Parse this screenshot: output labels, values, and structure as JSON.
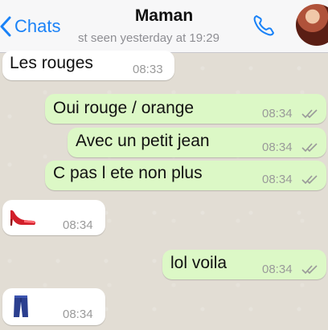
{
  "header": {
    "back_label": "Chats",
    "title": "Maman",
    "subtitle": "st seen yesterday at 19:29",
    "accent": "#1a82f7"
  },
  "messages": [
    {
      "direction": "in",
      "text": "Les rouges",
      "time": "08:33"
    },
    {
      "direction": "out",
      "text": "Oui rouge / orange",
      "time": "08:34",
      "status": "read"
    },
    {
      "direction": "out",
      "text": "Avec un petit jean",
      "time": "08:34",
      "status": "read"
    },
    {
      "direction": "out",
      "text": "C pas l ete non plus",
      "time": "08:34",
      "status": "read"
    },
    {
      "direction": "in",
      "emoji": "high-heel-shoe-icon",
      "time": "08:34"
    },
    {
      "direction": "out",
      "text": "lol voila",
      "time": "08:34",
      "status": "read"
    },
    {
      "direction": "in",
      "emoji": "jeans-icon",
      "time": "08:34"
    }
  ],
  "colors": {
    "incoming_bubble": "#ffffff",
    "outgoing_bubble": "#dcf8c6",
    "chat_background": "#e2ddd4",
    "tick_color": "#9a9a9a"
  }
}
